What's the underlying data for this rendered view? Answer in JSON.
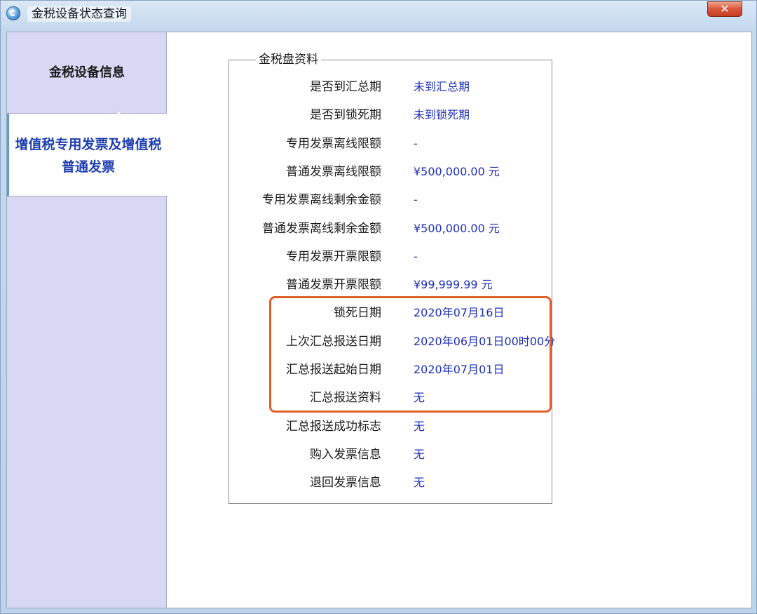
{
  "window": {
    "title": "金税设备状态查询",
    "close_label": "✕"
  },
  "sidebar": {
    "items": [
      {
        "label": "金税设备信息",
        "selected": false
      },
      {
        "label": "增值税专用发票及增值税普通发票",
        "selected": true
      }
    ]
  },
  "panel": {
    "legend": "金税盘资料",
    "rows": [
      {
        "label": "是否到汇总期",
        "value": "未到汇总期"
      },
      {
        "label": "是否到锁死期",
        "value": "未到锁死期"
      },
      {
        "label": "专用发票离线限额",
        "value": "-"
      },
      {
        "label": "普通发票离线限额",
        "value": "¥500,000.00 元"
      },
      {
        "label": "专用发票离线剩余金额",
        "value": "-"
      },
      {
        "label": "普通发票离线剩余金额",
        "value": "¥500,000.00 元"
      },
      {
        "label": "专用发票开票限额",
        "value": "-"
      },
      {
        "label": "普通发票开票限额",
        "value": "¥99,999.99 元"
      },
      {
        "label": "锁死日期",
        "value": "2020年07月16日"
      },
      {
        "label": "上次汇总报送日期",
        "value": "2020年06月01日00时00分"
      },
      {
        "label": "汇总报送起始日期",
        "value": "2020年07月01日"
      },
      {
        "label": "汇总报送资料",
        "value": "无"
      },
      {
        "label": "汇总报送成功标志",
        "value": "无"
      },
      {
        "label": "购入发票信息",
        "value": "无"
      },
      {
        "label": "退回发票信息",
        "value": "无"
      }
    ]
  },
  "colors": {
    "value_text": "#1f2fb8",
    "highlight_border": "#e0602a",
    "selected_nav_text": "#1f3fb0"
  }
}
